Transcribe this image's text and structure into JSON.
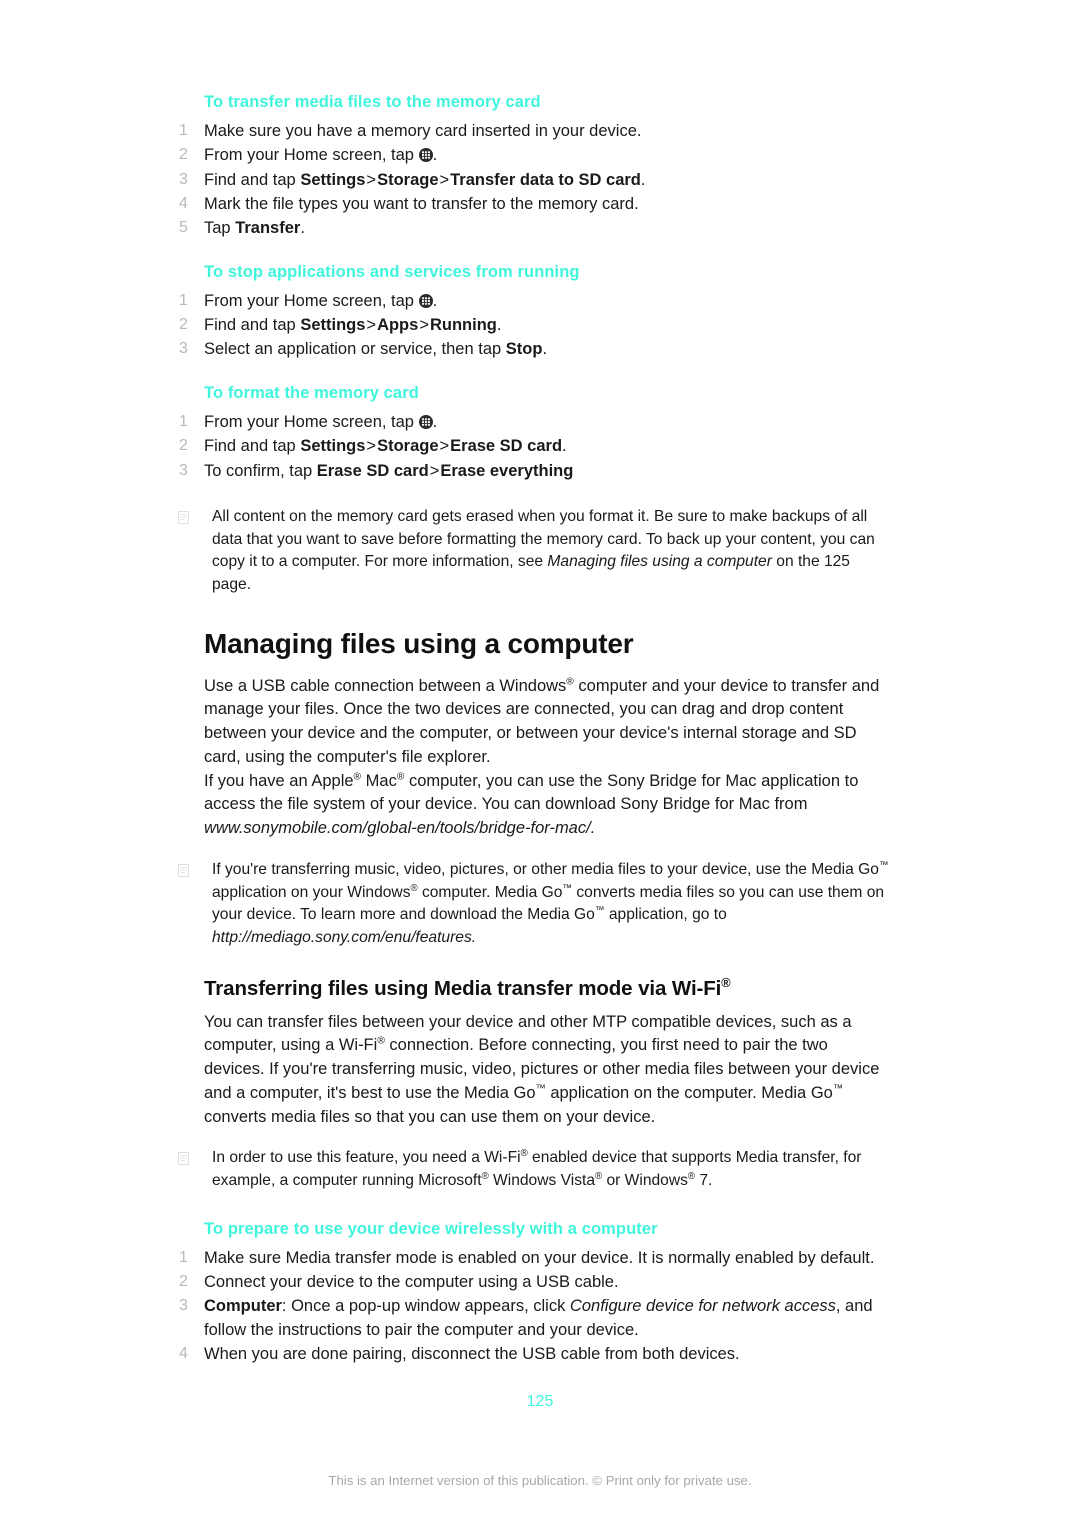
{
  "document": {
    "page_number": "125",
    "footer_notice": "This is an Internet version of this publication. © Print only for private use.",
    "accent_color": "#3ff5dc",
    "text_color": "#1a1a1a",
    "step_number_color": "#b9b9b9"
  },
  "sections": {
    "transfer_media": {
      "heading": "To transfer media files to the memory card",
      "steps": [
        "Make sure you have a memory card inserted in your device.",
        "From your Home screen, tap .",
        "Find and tap Settings > Storage > Transfer data to SD card.",
        "Mark the file types you want to transfer to the memory card.",
        "Tap Transfer."
      ],
      "step1": "Make sure you have a memory card inserted in your device.",
      "step2_pre": "From your Home screen, tap",
      "step2_post": ".",
      "step3_pre": "Find and tap ",
      "step3_b1": "Settings",
      "step3_b2": "Storage",
      "step3_b3": "Transfer data to SD card",
      "step3_post": ".",
      "step4": "Mark the file types you want to transfer to the memory card.",
      "step5_pre": "Tap ",
      "step5_b": "Transfer",
      "step5_post": "."
    },
    "stop_apps": {
      "heading": "To stop applications and services from running",
      "step1_pre": "From your Home screen, tap",
      "step1_post": ".",
      "step2_pre": "Find and tap ",
      "step2_b1": "Settings",
      "step2_b2": "Apps",
      "step2_b3": "Running",
      "step2_post": ".",
      "step3_pre": "Select an application or service, then tap ",
      "step3_b": "Stop",
      "step3_post": "."
    },
    "format_card": {
      "heading": "To format the memory card",
      "step1_pre": "From your Home screen, tap",
      "step1_post": ".",
      "step2_pre": "Find and tap ",
      "step2_b1": "Settings",
      "step2_b2": "Storage",
      "step2_b3": "Erase SD card",
      "step2_post": ".",
      "step3_pre": "To confirm, tap ",
      "step3_b1": "Erase SD card",
      "step3_b2": "Erase everything",
      "note_part1": "All content on the memory card gets erased when you format it. Be sure to make backups of all data that you want to save before formatting the memory card. To back up your content, you can copy it to a computer. For more information, see ",
      "note_italic": "Managing files using a computer",
      "note_part2": " on the 125 page."
    },
    "managing_files": {
      "title": "Managing files using a computer",
      "para1": "Use a USB cable connection between a Windows® computer and your device to transfer and manage your files. Once the two devices are connected, you can drag and drop content between your device and the computer, or between your device's internal storage and SD card, using the computer's file explorer.",
      "para1_a": "Use a USB cable connection between a Windows",
      "para1_b": " computer and your device to transfer and manage your files. Once the two devices are connected, you can drag and drop content between your device and the computer, or between your device's internal storage and SD card, using the computer's file explorer.",
      "para2_a": "If you have an Apple",
      "para2_b": " Mac",
      "para2_c": " computer, you can use the Sony Bridge for Mac application to access the file system of your device. You can download Sony Bridge for Mac from ",
      "para2_url": "www.sonymobile.com/global-en/tools/bridge-for-mac/.",
      "note_a": "If you're transferring music, video, pictures, or other media files to your device, use the Media Go",
      "note_b": " application on your Windows",
      "note_c": " computer. Media Go",
      "note_d": " converts media files so you can use them on your device. To learn more and download the Media Go",
      "note_e": " application, go to ",
      "note_url": "http://mediago.sony.com/enu/features."
    },
    "wifi_transfer": {
      "title_a": "Transferring files using Media transfer mode via Wi-Fi",
      "para_a": "You can transfer files between your device and other MTP compatible devices, such as a computer, using a Wi-Fi",
      "para_b": " connection. Before connecting, you first need to pair the two devices. If you're transferring music, video, pictures or other media files between your device and a computer, it's best to use the Media Go",
      "para_c": " application on the computer. Media Go",
      "para_d": " converts media files so that you can use them on your device.",
      "note_a": "In order to use this feature, you need a Wi-Fi",
      "note_b": " enabled device that supports Media transfer, for example, a computer running Microsoft",
      "note_c": " Windows Vista",
      "note_d": " or Windows",
      "note_e": " 7."
    },
    "prepare_wireless": {
      "heading": "To prepare to use your device wirelessly with a computer",
      "step1": "Make sure Media transfer mode is enabled on your device. It is normally enabled by default.",
      "step2": "Connect your device to the computer using a USB cable.",
      "step3_b": "Computer",
      "step3_pre": ": Once a pop-up window appears, click ",
      "step3_i1": "Configure device for network access",
      "step3_post": ", and follow the instructions to pair the computer and your device.",
      "step4": "When you are done pairing, disconnect the USB cable from both devices."
    }
  },
  "symbols": {
    "separator": ">",
    "registered": "®",
    "trademark": "™",
    "app_drawer_icon": "app-drawer-icon",
    "note_icon": "note-icon"
  }
}
